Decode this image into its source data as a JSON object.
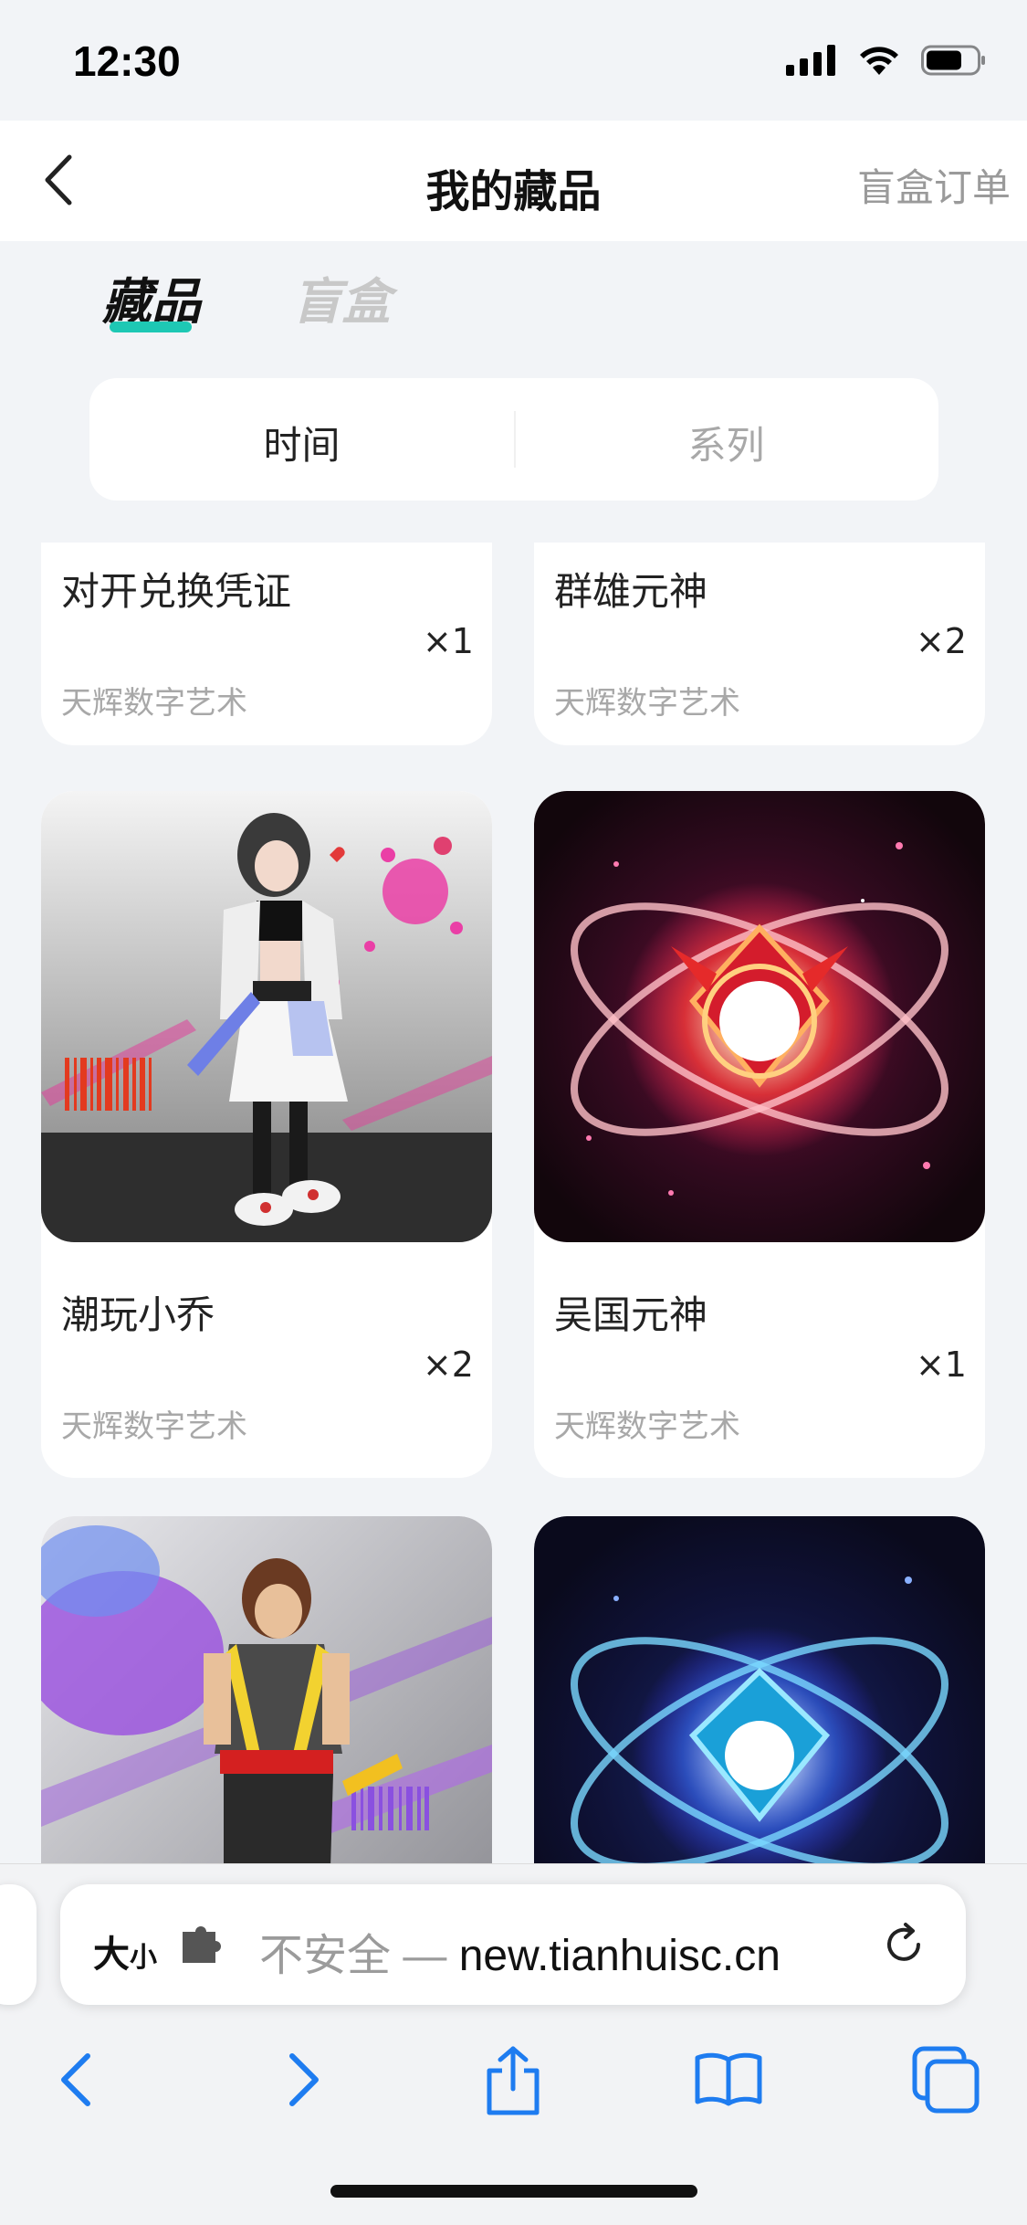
{
  "status_bar": {
    "time": "12:30"
  },
  "nav": {
    "title": "我的藏品",
    "action": "盲盒订单"
  },
  "tabs": [
    {
      "label": "藏品",
      "active": true
    },
    {
      "label": "盲盒",
      "active": false
    }
  ],
  "segment": {
    "items": [
      "时间",
      "系列"
    ],
    "selected": "时间"
  },
  "cards": [
    {
      "name": "对开兑换凭证",
      "qty": "×1",
      "brand": "天辉数字艺术",
      "thumb": ""
    },
    {
      "name": "群雄元神",
      "qty": "×2",
      "brand": "天辉数字艺术",
      "thumb": ""
    },
    {
      "name": "潮玩小乔",
      "qty": "×2",
      "brand": "天辉数字艺术",
      "thumb": "anime-girl-artwork"
    },
    {
      "name": "吴国元神",
      "qty": "×1",
      "brand": "天辉数字艺术",
      "thumb": "red-emblem-artwork"
    },
    {
      "name": "",
      "qty": "",
      "brand": "",
      "thumb": "warrior-artwork"
    },
    {
      "name": "",
      "qty": "",
      "brand": "",
      "thumb": "blue-emblem-artwork"
    }
  ],
  "browser": {
    "text_size_label": "大",
    "text_size_small": "小",
    "insecure_label": "不安全 — ",
    "domain": "new.tianhuisc.cn"
  },
  "icons": {
    "back": "chevron-left-icon",
    "reload": "reload-icon",
    "toolbar": [
      "chevron-left-icon",
      "chevron-right-icon",
      "share-icon",
      "bookmarks-icon",
      "tabs-icon"
    ]
  },
  "colors": {
    "accent": "#1ec8b4",
    "browser_tint": "#1e7cf0"
  }
}
